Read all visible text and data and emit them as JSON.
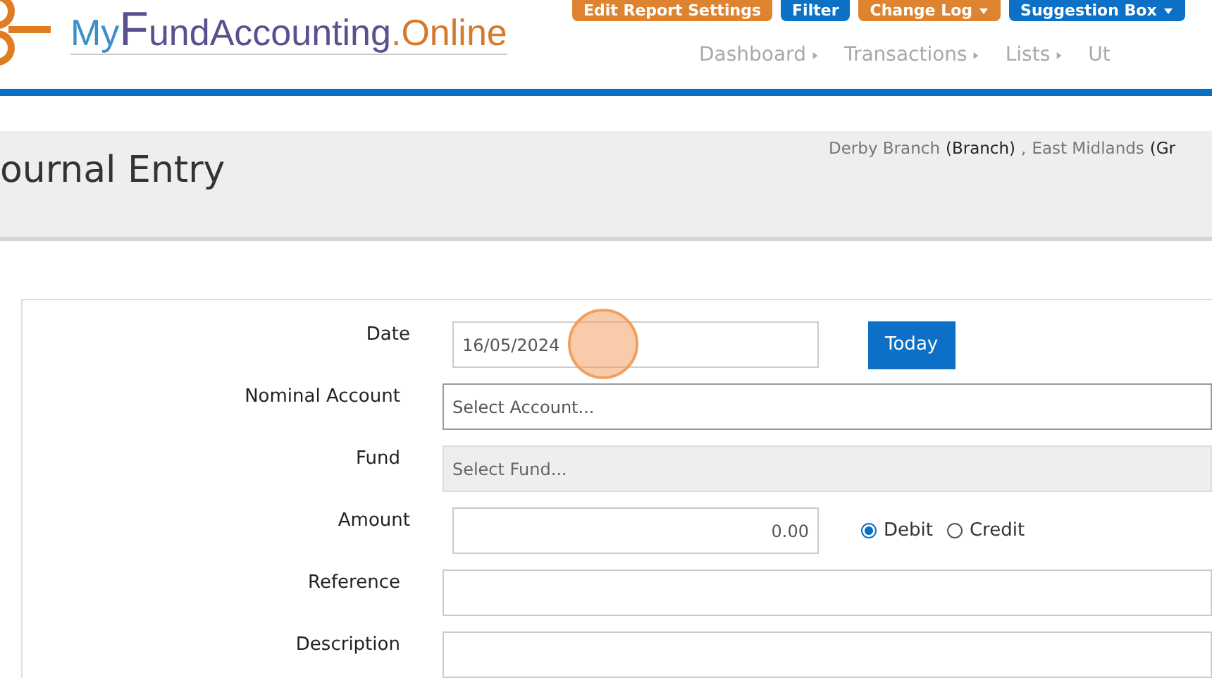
{
  "top_buttons": [
    {
      "label": "Edit Report Settings",
      "kind": "orange",
      "caret": false
    },
    {
      "label": "Filter",
      "kind": "blue",
      "caret": false
    },
    {
      "label": "Change Log",
      "kind": "orange",
      "caret": true
    },
    {
      "label": "Suggestion Box",
      "kind": "blue",
      "caret": true
    }
  ],
  "logo": {
    "my": "My",
    "fund_initial": "F",
    "fund_rest": "undAccounting",
    "online": ".Online"
  },
  "nav": [
    {
      "label": "Dashboard",
      "arrow": true
    },
    {
      "label": "Transactions",
      "arrow": true
    },
    {
      "label": "Lists",
      "arrow": true
    },
    {
      "label": "Ut",
      "arrow": false
    }
  ],
  "page_title": "ournal Entry",
  "branch": {
    "name": "Derby Branch",
    "type": "(Branch)",
    "separator": ",",
    "group": "East Midlands",
    "group_type": "(Gr"
  },
  "form": {
    "rows": [
      {
        "label": "Date",
        "kind": "date",
        "value": "16/05/2024",
        "button": "Today"
      },
      {
        "label": "Nominal Account",
        "kind": "select",
        "placeholder": "Select Account...",
        "disabled": false
      },
      {
        "label": "Fund",
        "kind": "select",
        "placeholder": "Select Fund...",
        "disabled": true
      },
      {
        "label": "Amount",
        "kind": "amount",
        "value": "0.00",
        "options": [
          {
            "label": "Debit",
            "selected": true
          },
          {
            "label": "Credit",
            "selected": false
          }
        ]
      },
      {
        "label": "Reference",
        "kind": "text",
        "value": ""
      },
      {
        "label": "Description",
        "kind": "text",
        "value": ""
      }
    ]
  }
}
